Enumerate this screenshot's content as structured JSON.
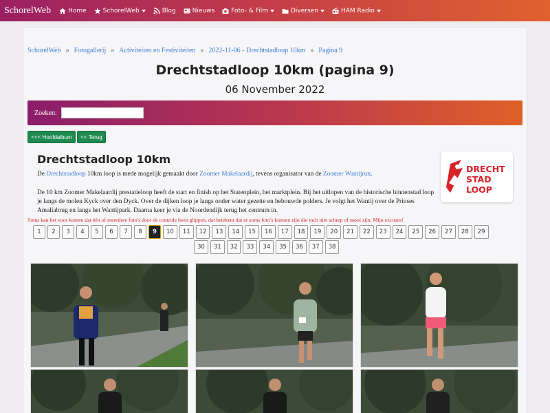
{
  "nav": {
    "brand": "SchorelWeb",
    "items": [
      {
        "label": "Home",
        "icon": "home-icon",
        "dropdown": false
      },
      {
        "label": "SchorelWeb",
        "icon": "star-icon",
        "dropdown": true
      },
      {
        "label": "Blog",
        "icon": "rss-icon",
        "dropdown": false
      },
      {
        "label": "Nieuws",
        "icon": "newspaper-icon",
        "dropdown": false
      },
      {
        "label": "Foto- & Film",
        "icon": "camera-icon",
        "dropdown": true
      },
      {
        "label": "Diversen",
        "icon": "folder-icon",
        "dropdown": true
      },
      {
        "label": "HAM Radio",
        "icon": "radio-icon",
        "dropdown": true
      }
    ]
  },
  "breadcrumb": [
    "SchorelWeb",
    "Fotogallerij",
    "Activiteiten en Festiviteiten",
    "2022-11-06 - Drechtstadloop 10km",
    "Pagina 9"
  ],
  "title": "Drechtstadloop 10km (pagina 9)",
  "date": "06 November 2022",
  "search": {
    "label": "Zoeken:",
    "value": ""
  },
  "buttons": {
    "album": "<<< Hoofdalbum",
    "back": "<< Terug"
  },
  "section_title": "Drechtstadloop 10km",
  "intro": {
    "p1_a": "De ",
    "p1_link1": "Drechtstadloop",
    "p1_b": " 10km loop is mede mogelijk gemaakt door ",
    "p1_link2": "Zoomer Makelaardij",
    "p1_c": ", tevens organisator van de ",
    "p1_link3": "Zoomer Wantijrun",
    "p1_d": ".",
    "p2": "De 10 km Zoomer Makelaardij prestatieloop heeft de start en finish op het Statenplein, het marktplein. Bij het uitlopen van de historische binnenstad loop je langs de molen Kyck over den Dyck. Over de dijken loop je langs onder water gezette en bebouwde polders. Je volgt het Wantij over de Prinses Amaliabrug en langs het Wantijpark. Daarna keer je via de Noordendijk terug het centrum in."
  },
  "logo": {
    "line1": "DRECHT",
    "line2": "STAD",
    "line3": "LOOP",
    "color": "#d8232a"
  },
  "warning": "Soms kan het voor komen dat één of meerdere foto's door de controle heen glippen, dat betekent dat er soms foto's kunnen zijn die toch niet scherp of mooi zijn. Mijn excuses!",
  "pages_row1": [
    "1",
    "2",
    "3",
    "4",
    "5",
    "6",
    "7",
    "8",
    "9",
    "10",
    "11",
    "12",
    "13",
    "14",
    "15",
    "16",
    "17",
    "18",
    "19",
    "20",
    "21",
    "22",
    "23",
    "24",
    "25",
    "26",
    "27",
    "28",
    "29"
  ],
  "pages_row2": [
    "30",
    "31",
    "32",
    "33",
    "34",
    "35",
    "36",
    "37",
    "38"
  ],
  "current_page": "9",
  "photos": [
    {
      "alt": "runner-photo-1"
    },
    {
      "alt": "runner-photo-2"
    },
    {
      "alt": "runner-photo-3"
    },
    {
      "alt": "runner-photo-4"
    },
    {
      "alt": "runner-photo-5"
    },
    {
      "alt": "runner-photo-6"
    }
  ],
  "colors": {
    "accent_link": "#3f7fd8",
    "button_green": "#1e8a50",
    "warning_red": "#d01f1f"
  }
}
